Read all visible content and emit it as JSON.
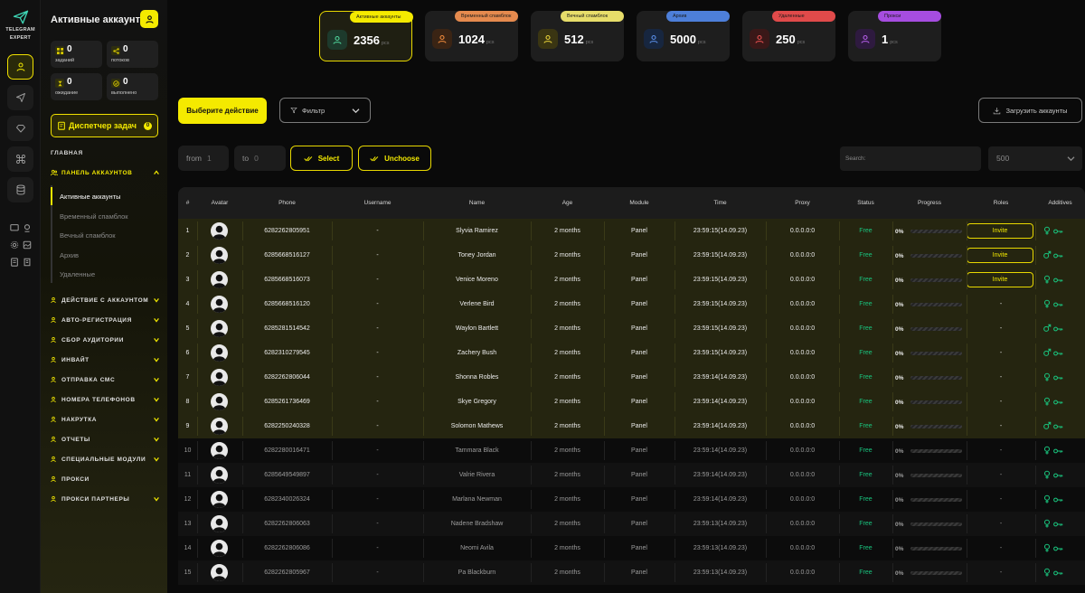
{
  "app": {
    "brand_line1": "TELEGRAM",
    "brand_line2": "EXPERT"
  },
  "sidebar": {
    "title": "Активные аккаунты",
    "stats": [
      {
        "value": "0",
        "label": "заданий",
        "icon": "grid-icon"
      },
      {
        "value": "0",
        "label": "потоков",
        "icon": "share-icon"
      },
      {
        "value": "0",
        "label": "ожидание",
        "icon": "hourglass-icon"
      },
      {
        "value": "0",
        "label": "выполнено",
        "icon": "check-circle-icon"
      }
    ],
    "dispatcher_label": "Диспетчер задач",
    "dispatcher_count": "0",
    "main_section": "ГЛАВНАЯ",
    "panel_label": "ПАНЕЛЬ АККАУНТОВ",
    "sub_items": [
      "Активные аккаунты",
      "Временный спамблок",
      "Вечный спамблок",
      "Архив",
      "Удаленные"
    ],
    "nav_items": [
      {
        "label": "ДЕЙСТВИЕ С АККАУНТОМ",
        "icon": "user-action-icon",
        "chevron": true
      },
      {
        "label": "АВТО-РЕГИСТРАЦИЯ",
        "icon": "user-plus-icon",
        "chevron": true
      },
      {
        "label": "СБОР АУДИТОРИИ",
        "icon": "users-icon",
        "chevron": true
      },
      {
        "label": "ИНВАЙТ",
        "icon": "invite-icon",
        "chevron": true
      },
      {
        "label": "ОТПРАВКА СМС",
        "icon": "send-icon",
        "chevron": true
      },
      {
        "label": "НОМЕРА ТЕЛЕФОНОВ",
        "icon": "phone-icon",
        "chevron": true
      },
      {
        "label": "НАКРУТКА",
        "icon": "boost-icon",
        "chevron": true
      },
      {
        "label": "ОТЧЕТЫ",
        "icon": "report-icon",
        "chevron": true
      },
      {
        "label": "СПЕЦИАЛЬНЫЕ МОДУЛИ",
        "icon": "modules-icon",
        "chevron": true
      },
      {
        "label": "ПРОКСИ",
        "icon": "proxy-icon",
        "chevron": false
      },
      {
        "label": "ПРОКСИ ПАРТНЕРЫ",
        "icon": "partners-icon",
        "chevron": true
      }
    ]
  },
  "cards": [
    {
      "label": "Активные аккаунты",
      "value": "2356",
      "unit": "pcs",
      "pill_color": "#f4ea00",
      "icon_bg": "#1d3a2c",
      "icon_color": "#4fd39a",
      "icon": "user-check-icon"
    },
    {
      "label": "Временный спамблок",
      "value": "1024",
      "unit": "pcs",
      "pill_color": "#e58a4e",
      "icon_bg": "#3a2414",
      "icon_color": "#f08a3c",
      "icon": "warning-icon"
    },
    {
      "label": "Вечный спамблок",
      "value": "512",
      "unit": "pcs",
      "pill_color": "#e7dd6a",
      "icon_bg": "#3a3512",
      "icon_color": "#e8d23a",
      "icon": "mail-block-icon"
    },
    {
      "label": "Архив",
      "value": "5000",
      "unit": "pcs",
      "pill_color": "#4d7fd9",
      "icon_bg": "#17263f",
      "icon_color": "#5a8ee8",
      "icon": "archive-icon"
    },
    {
      "label": "Удаленные",
      "value": "250",
      "unit": "pcs",
      "pill_color": "#e04a4a",
      "icon_bg": "#3a1818",
      "icon_color": "#e85050",
      "icon": "user-remove-icon"
    },
    {
      "label": "Прокси",
      "value": "1",
      "unit": "pcs",
      "pill_color": "#a64de0",
      "icon_bg": "#2e1a3f",
      "icon_color": "#b45ee8",
      "icon": "proxy-card-icon"
    }
  ],
  "toolbar": {
    "action_label": "Выберите действие",
    "filter_label": "Фильтр",
    "upload_label": "Загрузить аккаунты",
    "from_label": "from",
    "from_value": "1",
    "to_label": "to",
    "to_value": "0",
    "select_label": "Select",
    "unchoose_label": "Unchoose",
    "search_placeholder": "Search:",
    "page_size": "500"
  },
  "table": {
    "headers": [
      "#",
      "Avatar",
      "Phone",
      "Username",
      "Name",
      "Age",
      "Module",
      "Time",
      "Proxy",
      "Status",
      "Progress",
      "Roles",
      "Additives"
    ],
    "rows": [
      {
        "n": "1",
        "phone": "6282262805951",
        "username": "-",
        "name": "Slyvia Ramirez",
        "age": "2 months",
        "module": "Panel",
        "time": "23:59:15(14.09.23)",
        "proxy": "0.0.0.0:0",
        "status": "Free",
        "progress": "0%",
        "role": "Invite",
        "gender": "female",
        "selected": true
      },
      {
        "n": "2",
        "phone": "6285668516127",
        "username": "-",
        "name": "Toney Jordan",
        "age": "2 months",
        "module": "Panel",
        "time": "23:59:15(14.09.23)",
        "proxy": "0.0.0.0:0",
        "status": "Free",
        "progress": "0%",
        "role": "Invite",
        "gender": "male",
        "selected": true
      },
      {
        "n": "3",
        "phone": "6285668516073",
        "username": "-",
        "name": "Venice Moreno",
        "age": "2 months",
        "module": "Panel",
        "time": "23:59:15(14.09.23)",
        "proxy": "0.0.0.0:0",
        "status": "Free",
        "progress": "0%",
        "role": "Invite",
        "gender": "female",
        "selected": true
      },
      {
        "n": "4",
        "phone": "6285668516120",
        "username": "-",
        "name": "Verlene Bird",
        "age": "2 months",
        "module": "Panel",
        "time": "23:59:15(14.09.23)",
        "proxy": "0.0.0.0:0",
        "status": "Free",
        "progress": "0%",
        "role": "-",
        "gender": "female",
        "selected": true
      },
      {
        "n": "5",
        "phone": "6285281514542",
        "username": "-",
        "name": "Waylon Bartlett",
        "age": "2 months",
        "module": "Panel",
        "time": "23:59:15(14.09.23)",
        "proxy": "0.0.0.0:0",
        "status": "Free",
        "progress": "0%",
        "role": "-",
        "gender": "male",
        "selected": true
      },
      {
        "n": "6",
        "phone": "6282310279545",
        "username": "-",
        "name": "Zachery Bush",
        "age": "2 months",
        "module": "Panel",
        "time": "23:59:15(14.09.23)",
        "proxy": "0.0.0.0:0",
        "status": "Free",
        "progress": "0%",
        "role": "-",
        "gender": "male",
        "selected": true
      },
      {
        "n": "7",
        "phone": "6282262806044",
        "username": "-",
        "name": "Shonna Robles",
        "age": "2 months",
        "module": "Panel",
        "time": "23:59:14(14.09.23)",
        "proxy": "0.0.0.0:0",
        "status": "Free",
        "progress": "0%",
        "role": "-",
        "gender": "female",
        "selected": true
      },
      {
        "n": "8",
        "phone": "6285261736469",
        "username": "-",
        "name": "Skye Gregory",
        "age": "2 months",
        "module": "Panel",
        "time": "23:59:14(14.09.23)",
        "proxy": "0.0.0.0:0",
        "status": "Free",
        "progress": "0%",
        "role": "-",
        "gender": "female",
        "selected": true
      },
      {
        "n": "9",
        "phone": "6282250240328",
        "username": "-",
        "name": "Solomon Mathews",
        "age": "2 months",
        "module": "Panel",
        "time": "23:59:14(14.09.23)",
        "proxy": "0.0.0.0:0",
        "status": "Free",
        "progress": "0%",
        "role": "-",
        "gender": "male",
        "selected": true
      },
      {
        "n": "10",
        "phone": "6282280016471",
        "username": "-",
        "name": "Tammara Black",
        "age": "2 months",
        "module": "Panel",
        "time": "23:59:14(14.09.23)",
        "proxy": "0.0.0.0:0",
        "status": "Free",
        "progress": "0%",
        "role": "-",
        "gender": "female",
        "selected": false
      },
      {
        "n": "11",
        "phone": "6285649549897",
        "username": "-",
        "name": "Valrie Rivera",
        "age": "2 months",
        "module": "Panel",
        "time": "23:59:14(14.09.23)",
        "proxy": "0.0.0.0:0",
        "status": "Free",
        "progress": "0%",
        "role": "-",
        "gender": "female",
        "selected": false
      },
      {
        "n": "12",
        "phone": "6282340026324",
        "username": "-",
        "name": "Marlana Newman",
        "age": "2 months",
        "module": "Panel",
        "time": "23:59:14(14.09.23)",
        "proxy": "0.0.0.0:0",
        "status": "Free",
        "progress": "0%",
        "role": "-",
        "gender": "female",
        "selected": false
      },
      {
        "n": "13",
        "phone": "6282262806063",
        "username": "-",
        "name": "Nadene Bradshaw",
        "age": "2 months",
        "module": "Panel",
        "time": "23:59:13(14.09.23)",
        "proxy": "0.0.0.0:0",
        "status": "Free",
        "progress": "0%",
        "role": "-",
        "gender": "female",
        "selected": false
      },
      {
        "n": "14",
        "phone": "6282262806086",
        "username": "-",
        "name": "Neomi Avila",
        "age": "2 months",
        "module": "Panel",
        "time": "23:59:13(14.09.23)",
        "proxy": "0.0.0.0:0",
        "status": "Free",
        "progress": "0%",
        "role": "-",
        "gender": "female",
        "selected": false
      },
      {
        "n": "15",
        "phone": "6282262805967",
        "username": "-",
        "name": "Pa Blackburn",
        "age": "2 months",
        "module": "Panel",
        "time": "23:59:13(14.09.23)",
        "proxy": "0.0.0.0:0",
        "status": "Free",
        "progress": "0%",
        "role": "-",
        "gender": "female",
        "selected": false
      }
    ],
    "colors": {
      "accent": "#f4ea00",
      "status_free": "#19c37d",
      "selected_row": "#252510",
      "row_even": "#121212",
      "row_odd": "#0c0c0c"
    }
  }
}
